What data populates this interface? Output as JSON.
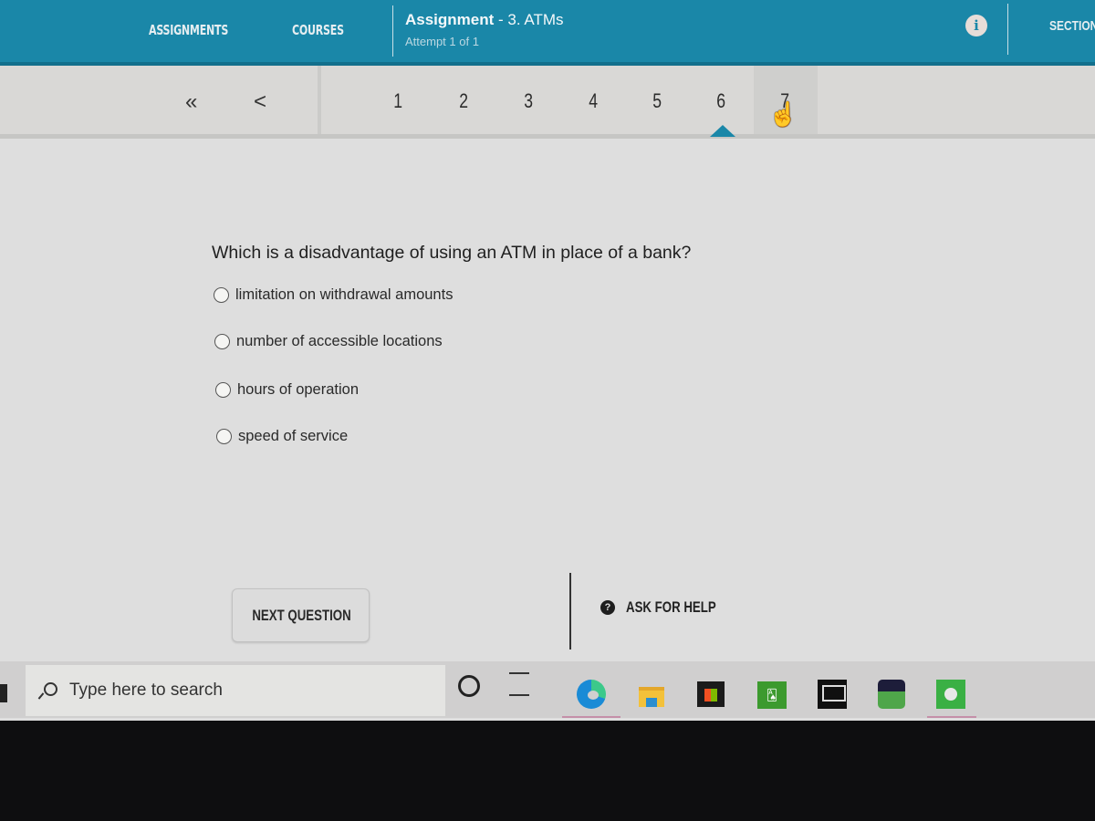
{
  "header": {
    "nav": [
      {
        "label": "ASSIGNMENTS"
      },
      {
        "label": "COURSES"
      }
    ],
    "assignment_label": "Assignment",
    "assignment_name": " - 3. ATMs",
    "attempt": "Attempt 1 of 1",
    "info_icon": "info-icon",
    "section_label": "SECTION"
  },
  "pager": {
    "first_glyph": "«",
    "prev_glyph": "<",
    "pages": [
      "1",
      "2",
      "3",
      "4",
      "5",
      "6",
      "7"
    ],
    "current_page": "6"
  },
  "question": {
    "text": "Which is a disadvantage of using an ATM in place of a bank?",
    "options": [
      {
        "label": "limitation on withdrawal amounts",
        "selected": false
      },
      {
        "label": "number of accessible locations",
        "selected": false
      },
      {
        "label": "hours of operation",
        "selected": false
      },
      {
        "label": "speed of service",
        "selected": false
      }
    ]
  },
  "actions": {
    "next_label": "NEXT QUESTION",
    "help_label": "ASK FOR HELP",
    "help_icon_glyph": "?"
  },
  "taskbar": {
    "search_placeholder": "Type here to search",
    "apps": [
      "cortana",
      "task-view",
      "edge",
      "file-explorer",
      "microsoft-store",
      "solitaire",
      "laptop-app",
      "kidomi",
      "spotify"
    ]
  },
  "colors": {
    "accent": "#1a87a8",
    "background": "#dedede"
  }
}
